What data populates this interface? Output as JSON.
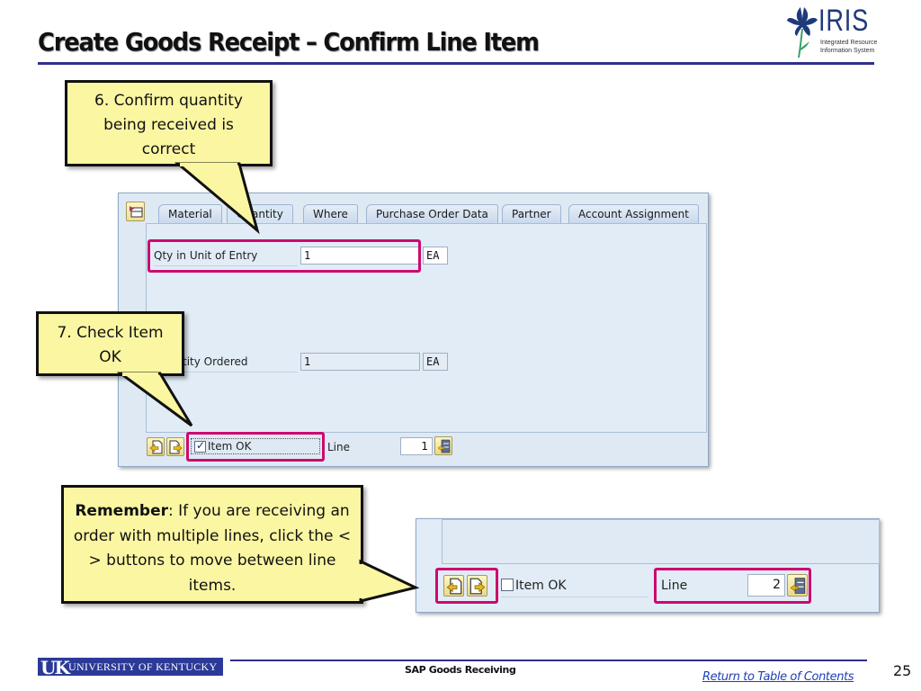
{
  "header": {
    "title": "Create Goods Receipt – Confirm Line Item",
    "logo": {
      "name": "IRIS",
      "subtitle_line1": "Integrated Resource",
      "subtitle_line2": "Information System",
      "icon": "iris-flower-icon"
    },
    "accent_color": "#2e2e8a"
  },
  "callouts": {
    "step6": "6. Confirm quantity being received is correct",
    "step7": "7. Check Item OK",
    "remember_bold": "Remember",
    "remember_text": ": If you are receiving an order with multiple lines, click the < > buttons to move between line items.",
    "fill_color": "#fbf6a2"
  },
  "sap_screen": {
    "tabs": [
      {
        "label": "Material",
        "active": false
      },
      {
        "label": "Quantity",
        "active": true
      },
      {
        "label": "Where",
        "active": false
      },
      {
        "label": "Purchase Order Data",
        "active": false
      },
      {
        "label": "Partner",
        "active": false
      },
      {
        "label": "Account Assignment",
        "active": false
      }
    ],
    "fields": {
      "qty_unit_entry": {
        "label": "Qty in Unit of Entry",
        "value": "1",
        "unit": "EA"
      },
      "qty_ordered": {
        "label": "Quantity Ordered",
        "visible_label": "ity Ordered",
        "value": "1",
        "unit": "EA"
      }
    },
    "bottom_bar": {
      "prev_icon": "previous-item-icon",
      "next_icon": "next-item-icon",
      "item_ok_label": "Item OK",
      "item_ok_checked": true,
      "line_label": "Line",
      "line_value": "1",
      "line_nav_icon": "go-to-line-icon"
    },
    "highlight_color": "#cc0a6e"
  },
  "detail_screen": {
    "item_ok_label": "Item OK",
    "item_ok_checked": false,
    "line_label": "Line",
    "line_value": "2"
  },
  "footer": {
    "university": "UNIVERSITY OF KENTUCKY",
    "uk_mark": "UK",
    "center": "SAP Goods Receiving",
    "toc_link": "Return to Table of Contents",
    "page_number": "25"
  }
}
